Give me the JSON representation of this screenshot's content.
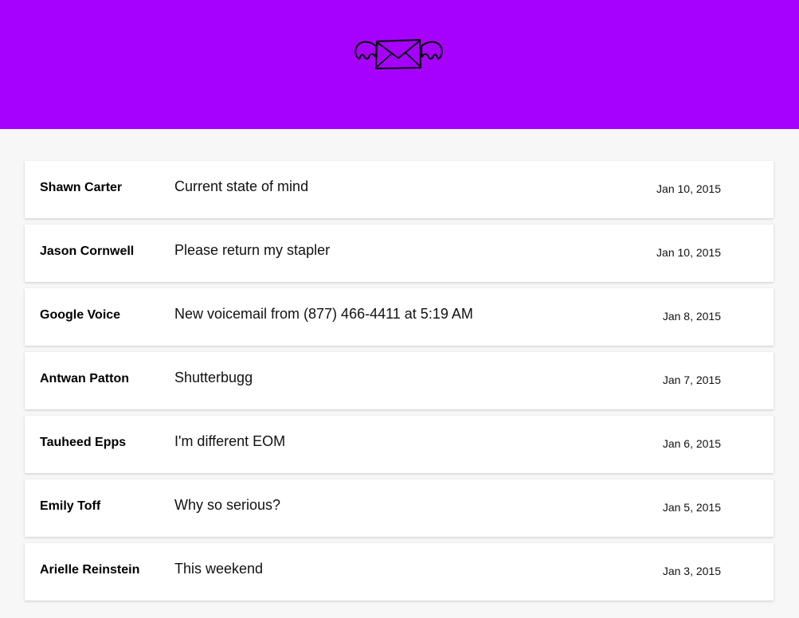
{
  "header": {
    "background": "#a600ff",
    "logo_icon": "winged-envelope-icon"
  },
  "messages": [
    {
      "sender": "Shawn Carter",
      "subject": "Current state of mind",
      "date": "Jan 10, 2015"
    },
    {
      "sender": "Jason Cornwell",
      "subject": "Please return my stapler",
      "date": "Jan 10, 2015"
    },
    {
      "sender": "Google Voice",
      "subject": "New voicemail from (877) 466-4411 at 5:19 AM",
      "date": "Jan 8, 2015"
    },
    {
      "sender": "Antwan Patton",
      "subject": "Shutterbugg",
      "date": "Jan 7, 2015"
    },
    {
      "sender": "Tauheed Epps",
      "subject": "I'm different EOM",
      "date": "Jan 6, 2015"
    },
    {
      "sender": "Emily Toff",
      "subject": "Why so serious?",
      "date": "Jan 5, 2015"
    },
    {
      "sender": "Arielle Reinstein",
      "subject": "This weekend",
      "date": "Jan 3, 2015"
    }
  ]
}
